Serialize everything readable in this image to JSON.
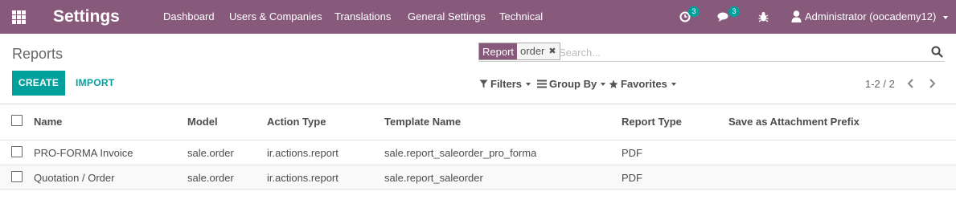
{
  "navbar": {
    "brand": "Settings",
    "menu": [
      "Dashboard",
      "Users & Companies",
      "Translations",
      "General Settings",
      "Technical"
    ],
    "activity_count": "3",
    "messages_count": "3",
    "user_name": "Administrator (oocademy12)"
  },
  "control_panel": {
    "breadcrumb": "Reports",
    "search": {
      "facet_label": "Report",
      "facet_value": "order",
      "placeholder": "Search..."
    },
    "buttons": {
      "create": "CREATE",
      "import": "IMPORT"
    },
    "search_view": {
      "filters": "Filters",
      "group_by": "Group By",
      "favorites": "Favorites"
    },
    "pager": "1-2 / 2"
  },
  "table": {
    "columns": [
      "Name",
      "Model",
      "Action Type",
      "Template Name",
      "Report Type",
      "Save as Attachment Prefix"
    ],
    "rows": [
      [
        "PRO-FORMA Invoice",
        "sale.order",
        "ir.actions.report",
        "sale.report_saleorder_pro_forma",
        "PDF",
        ""
      ],
      [
        "Quotation / Order",
        "sale.order",
        "ir.actions.report",
        "sale.report_saleorder",
        "PDF",
        ""
      ]
    ]
  },
  "colors": {
    "navbar": "#875a7b",
    "primary": "#00a09d"
  }
}
